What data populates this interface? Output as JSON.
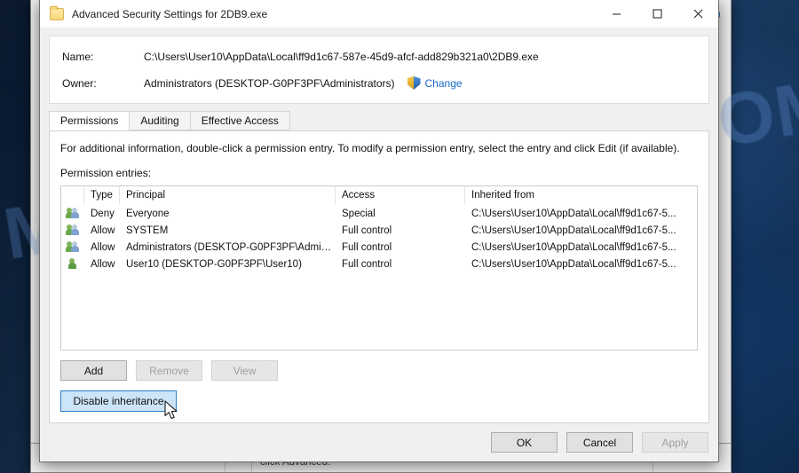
{
  "window": {
    "title": "Advanced Security Settings for 2DB9.exe",
    "icon": "folder-icon",
    "controls": {
      "minimize": "─",
      "maximize": "☐",
      "close": "✕"
    }
  },
  "info": {
    "name_label": "Name:",
    "name_value": "C:\\Users\\User10\\AppData\\Local\\ff9d1c67-587e-45d9-afcf-add829b321a0\\2DB9.exe",
    "owner_label": "Owner:",
    "owner_value": "Administrators (DESKTOP-G0PF3PF\\Administrators)",
    "change_link": "Change",
    "shield_icon": "uac-shield-icon"
  },
  "tabs": [
    {
      "label": "Permissions",
      "active": true
    },
    {
      "label": "Auditing",
      "active": false
    },
    {
      "label": "Effective Access",
      "active": false
    }
  ],
  "main": {
    "description": "For additional information, double-click a permission entry. To modify a permission entry, select the entry and click Edit (if available).",
    "entries_label": "Permission entries:",
    "columns": [
      "Type",
      "Principal",
      "Access",
      "Inherited from"
    ],
    "rows": [
      {
        "icon": "group-icon",
        "type": "Deny",
        "principal": "Everyone",
        "access": "Special",
        "inherited": "C:\\Users\\User10\\AppData\\Local\\ff9d1c67-5..."
      },
      {
        "icon": "group-icon",
        "type": "Allow",
        "principal": "SYSTEM",
        "access": "Full control",
        "inherited": "C:\\Users\\User10\\AppData\\Local\\ff9d1c67-5..."
      },
      {
        "icon": "group-icon",
        "type": "Allow",
        "principal": "Administrators (DESKTOP-G0PF3PF\\Admini...",
        "access": "Full control",
        "inherited": "C:\\Users\\User10\\AppData\\Local\\ff9d1c67-5..."
      },
      {
        "icon": "user-icon",
        "type": "Allow",
        "principal": "User10 (DESKTOP-G0PF3PF\\User10)",
        "access": "Full control",
        "inherited": "C:\\Users\\User10\\AppData\\Local\\ff9d1c67-5..."
      }
    ],
    "buttons": {
      "add": "Add",
      "remove": "Remove",
      "view": "View",
      "disable_inheritance": "Disable inheritance"
    }
  },
  "footer": {
    "ok": "OK",
    "cancel": "Cancel",
    "apply": "Apply"
  },
  "background_window": {
    "help_glyph": "?",
    "text": "click Advanced."
  },
  "watermark": "MYANTISPYWARE.COM",
  "colors": {
    "link": "#1768c4",
    "hover_button_border": "#2a7fc9",
    "hover_button_fill": "#cce4f7",
    "desktop": "#0b2748",
    "dialog_face": "#f0f0f0"
  }
}
